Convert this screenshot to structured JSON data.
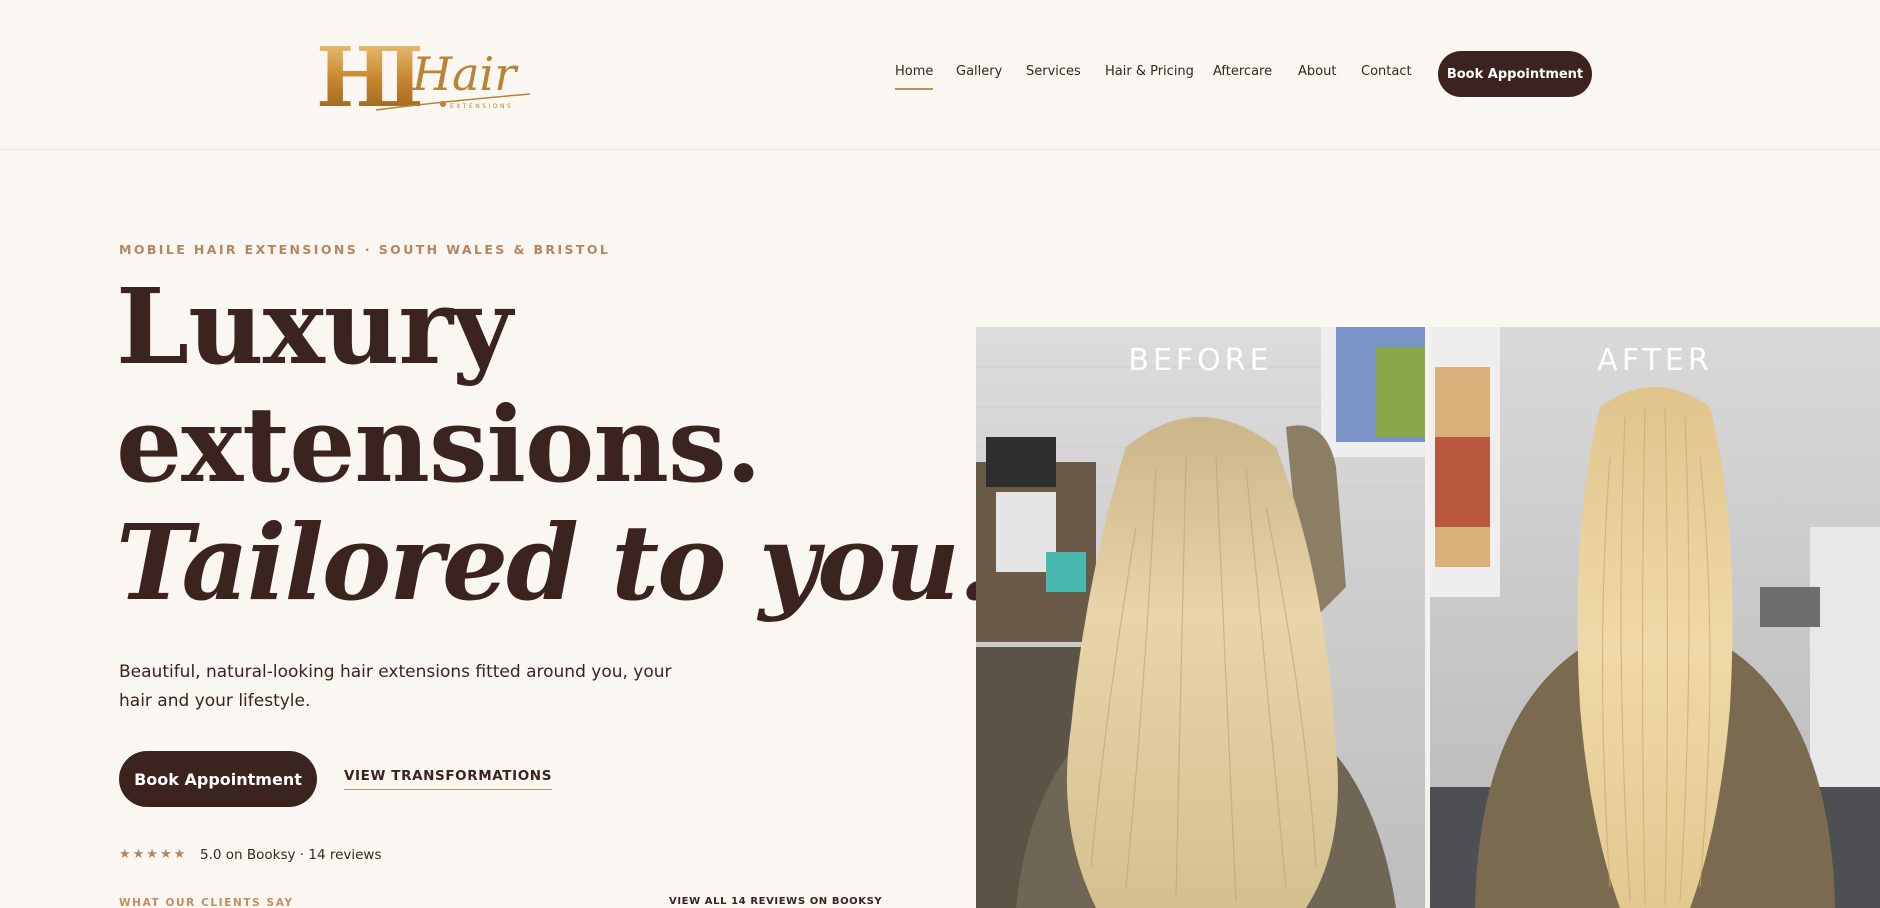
{
  "header": {
    "logo_alt": "HI Hair Extensions",
    "logo_letters": "HI",
    "logo_script": "Hair",
    "logo_sub": "EXTENSIONS",
    "nav": [
      {
        "label": "Home",
        "active": true
      },
      {
        "label": "Gallery",
        "active": false
      },
      {
        "label": "Services",
        "active": false
      },
      {
        "label": "Hair & Pricing",
        "active": false
      },
      {
        "label": "Aftercare",
        "active": false
      },
      {
        "label": "About",
        "active": false
      },
      {
        "label": "Contact",
        "active": false
      }
    ],
    "book_label": "Book Appointment"
  },
  "hero": {
    "eyebrow": "MOBILE HAIR EXTENSIONS · SOUTH WALES & BRISTOL",
    "headline_line1": "Luxury",
    "headline_line2": "extensions.",
    "headline_line3": "Tailored to you.",
    "subtext": "Beautiful, natural-looking hair extensions fitted around you, your hair and your lifestyle.",
    "cta_primary": "Book Appointment",
    "cta_secondary": "VIEW TRANSFORMATIONS",
    "stars": "★★★★★",
    "rating_text": "5.0 on Booksy · 14 reviews",
    "clients_say": "WHAT OUR CLIENTS SAY",
    "view_all": "VIEW ALL 14 REVIEWS ON BOOKSY"
  },
  "before_after": {
    "before_label": "BEFORE",
    "after_label": "AFTER"
  },
  "colors": {
    "background": "#faf6f2",
    "brand_dark": "#3b231f",
    "accent_gold": "#c28e5f"
  }
}
